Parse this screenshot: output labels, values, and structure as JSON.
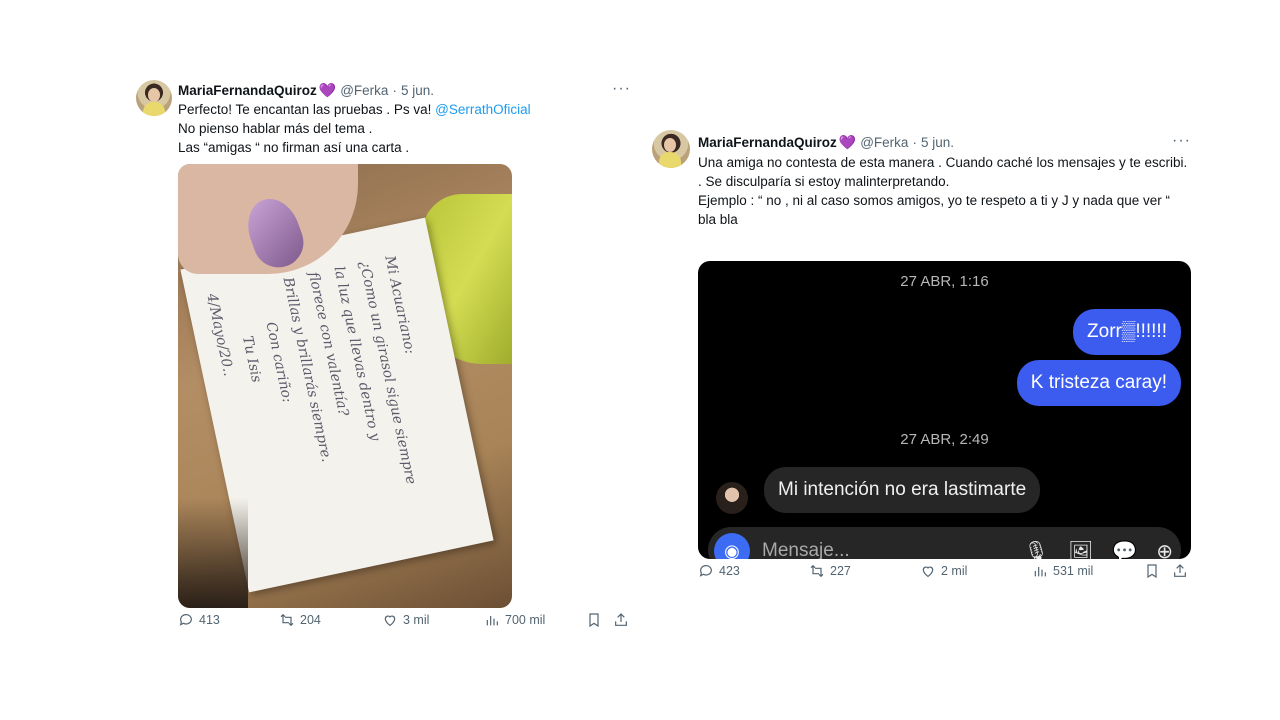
{
  "tweet1": {
    "author_name": "MariaFernandaQuiroz",
    "name_emoji": "💜",
    "handle": "@Ferka",
    "separator": "·",
    "date": "5 jun.",
    "more_label": "···",
    "text_line1": "Perfecto! Te encantan las pruebas . Ps va! ",
    "mention": "@SerrathOficial",
    "text_line2": "No pienso hablar más del tema .",
    "text_line3": "Las “amigas “ no firman así una carta .",
    "card_handwriting": "Mi Acuariano:\n¿Como un girasol sigue siempre\nla luz que llevas dentro y\nflorece con valentía?\nBrillas y brillarás siempre.\n         Con cariño:\n           Tu Isis\n4/Mayo/20..",
    "stats": {
      "replies": "413",
      "retweets": "204",
      "likes": "3 mil",
      "views": "700 mil"
    }
  },
  "tweet2": {
    "author_name": "MariaFernandaQuiroz",
    "name_emoji": "💜",
    "handle": "@Ferka",
    "separator": "·",
    "date": "5 jun.",
    "more_label": "···",
    "text_line1": "Una amiga no contesta de esta manera .  Cuando caché los mensajes y te escribi.",
    "text_line2": ". Se disculparía si estoy malinterpretando.",
    "text_line3": "Ejemplo : “ no , ni al caso  somos amigos, yo te respeto a ti y J y nada que ver “  bla bla",
    "chat": {
      "date1": "27 ABR, 1:16",
      "msg_out1": "Zorr▒!!!!!!",
      "msg_out2": "K tristeza caray!",
      "date2": "27 ABR, 2:49",
      "msg_in1": "Mi intención no era lastimarte",
      "composer_placeholder": "Mensaje..."
    },
    "stats": {
      "replies": "423",
      "retweets": "227",
      "likes": "2 mil",
      "views": "531 mil"
    }
  }
}
